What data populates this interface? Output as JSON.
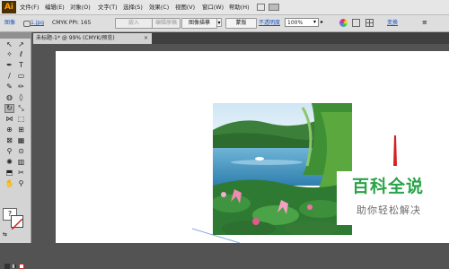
{
  "app": {
    "logo": "Ai"
  },
  "menu": [
    "文件(F)",
    "编辑(E)",
    "对象(O)",
    "文字(T)",
    "选择(S)",
    "效果(C)",
    "视图(V)",
    "窗口(W)",
    "帮助(H)"
  ],
  "control_bar": {
    "selection_label": "图像",
    "link_name": "1.jpg",
    "color_info": "CMYK  PPI: 165",
    "embed_button": "嵌入",
    "edit_original_button": "编辑原稿",
    "image_trace_button": "图像描摹",
    "mask_button": "蒙版",
    "opacity_label": "不透明度",
    "opacity_value": "100%",
    "transform_label": "变换"
  },
  "document_tab": {
    "title": "未标题-1* @ 99% (CMYK/预览)",
    "close": "×"
  },
  "tools": {
    "active": "rotate-tool",
    "help_glyph": "?"
  },
  "watermark": {
    "title": "百科全说",
    "subtitle": "助你轻松解决",
    "color": "#29a347"
  },
  "colors": {
    "app_bg": "#535353",
    "menubar": "#e6e6e6",
    "artboard": "#ffffff",
    "accent_red": "#d62020",
    "selection_blue": "#8aa8e0"
  }
}
